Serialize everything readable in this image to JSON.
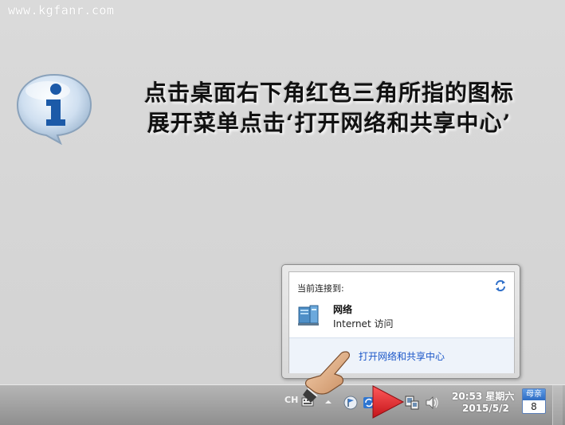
{
  "watermark": "www.kgfanr.com",
  "instruction": {
    "line1": "点击桌面右下角红色三角所指的图标",
    "line2": "展开菜单点击‘打开网络和共享中心’"
  },
  "popup": {
    "header": "当前连接到:",
    "network_name": "网络",
    "network_status": "Internet 访问",
    "open_center_link": "打开网络和共享中心"
  },
  "taskbar": {
    "language": "CH",
    "clock_time": "20:53 星期六",
    "clock_date": "2015/5/2",
    "calendar_top": "母亲",
    "calendar_day": "8"
  },
  "colors": {
    "link": "#1a56c8",
    "pointer_triangle": "#e0262b",
    "popup_footer": "#eef3fa"
  },
  "icons": [
    "info-icon",
    "refresh-icon",
    "network-icon",
    "hand-icon",
    "red-triangle-pointer",
    "volume-icon",
    "network-tray-icon",
    "flag-icon",
    "calendar-icon"
  ]
}
